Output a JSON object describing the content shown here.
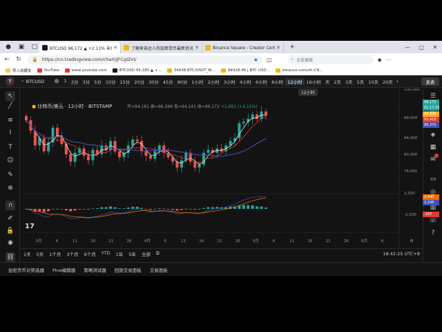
{
  "browser": {
    "tabs": [
      {
        "label": "BTCUSD 96,172 ▲ +2.11% 未命名",
        "active": true,
        "favicon_color": "#131722"
      },
      {
        "label": "了解来自达人的加密货币最新资讯",
        "active": false,
        "favicon_color": "#f0b90b"
      },
      {
        "label": "Binance Square - Creator Center",
        "active": false,
        "favicon_color": "#f0b90b"
      }
    ],
    "url": "https://cn.tradingview.com/chart/JFCgIZnl/",
    "search_placeholder": "点击搜索",
    "bookmarks": [
      {
        "label": "导入收藏夹",
        "color": "#f2c94c"
      },
      {
        "label": "YouTube",
        "color": "#e53935"
      },
      {
        "label": "www.youtube.com",
        "color": "#e53935"
      },
      {
        "label": "BTCUSD 95,185 ▲ +...",
        "color": "#131722"
      },
      {
        "label": "34938 BTC/USDT_Bi...",
        "color": "#f0b90b"
      },
      {
        "label": "94928.46 | BTC USD...",
        "color": "#f0b90b"
      },
      {
        "label": "binance.com/zh-CN...",
        "color": "#f0b90b"
      }
    ]
  },
  "tv": {
    "avatar_letter": "T",
    "symbol": "BTCUSD",
    "intervals": [
      "1",
      "2分",
      "3分",
      "5分",
      "10分",
      "15分",
      "20分",
      "30分",
      "45分",
      "90分",
      "1小时",
      "2小时",
      "3小时",
      "4小时",
      "6小时",
      "8小时",
      "12小时",
      "16小时",
      "天",
      "2天",
      "3天",
      "5天",
      "10天",
      "20天"
    ],
    "selected_interval": "12小时",
    "tooltip": "12小时",
    "publish_label": "发表",
    "legend_title": "比特币/美元 · 12小时 · BITSTAMP",
    "ohlc": {
      "open": "开=94,181",
      "high": "高=96,399",
      "low": "低=94,141",
      "close": "收=96,172",
      "change": "+1,991 (+2.11%)"
    },
    "price_scale": [
      "100,000",
      "88,000",
      "84,000",
      "80,000",
      "76,000"
    ],
    "osc_scale": [
      "2,500",
      "-2,500"
    ],
    "price_tags": [
      {
        "label": "96,172",
        "color": "#26a69a"
      },
      {
        "label": "01:17:35",
        "color": "#26a69a"
      },
      {
        "label": "94,309",
        "color": "#f9a825"
      },
      {
        "label": "93,418",
        "color": "#e53935"
      },
      {
        "label": "89,375",
        "color": "#3f51b5"
      }
    ],
    "osc_tags": [
      {
        "label": "2,440",
        "color": "#ef6c00"
      },
      {
        "label": "2,248",
        "color": "#3f51b5"
      },
      {
        "label": "-197",
        "color": "#e53935"
      }
    ],
    "time_axis": [
      "3月",
      "6",
      "11",
      "16",
      "21",
      "26",
      "4月",
      "6",
      "11",
      "16",
      "21",
      "26",
      "5月",
      "6",
      "11",
      "16",
      "21",
      "26",
      "6月",
      "6"
    ],
    "ranges": [
      "1天",
      "5天",
      "1个月",
      "3个月",
      "6个月",
      "YTD",
      "1年",
      "5年",
      "全部"
    ],
    "clock": "18:42:25 UTC+8",
    "panels": [
      "加密货币对筛选器",
      "Pine编辑器",
      "策略测试器",
      "回放交易面板",
      "交易面板"
    ]
  },
  "chart_data": {
    "type": "candlestick",
    "title": "比特币/美元 · 12小时 · BITSTAMP",
    "ylim": [
      72000,
      102000
    ],
    "x_labels": [
      "3月",
      "6",
      "11",
      "16",
      "21",
      "26",
      "4月",
      "6",
      "11",
      "16",
      "21",
      "26",
      "5月"
    ],
    "close_series": [
      94500,
      91000,
      86000,
      88500,
      84000,
      87000,
      92000,
      89000,
      86500,
      83000,
      80500,
      83500,
      85000,
      82500,
      81000,
      84500,
      83000,
      86000,
      84500,
      87500,
      84000,
      82000,
      83500,
      86000,
      88000,
      87500,
      84000,
      82500,
      81500,
      84000,
      86000,
      83500,
      82000,
      80500,
      78500,
      81000,
      83500,
      80500,
      78500,
      79500,
      83500,
      84500,
      83500,
      85000,
      84000,
      86000,
      87500,
      88500,
      93500,
      94000,
      95000,
      96500,
      95000,
      97500,
      96172
    ],
    "moving_averages": [
      {
        "name": "MA fast",
        "color": "#e8e8e8"
      },
      {
        "name": "MA mid",
        "color": "#e53935"
      },
      {
        "name": "MA slow",
        "color": "#3f51b5"
      }
    ]
  }
}
